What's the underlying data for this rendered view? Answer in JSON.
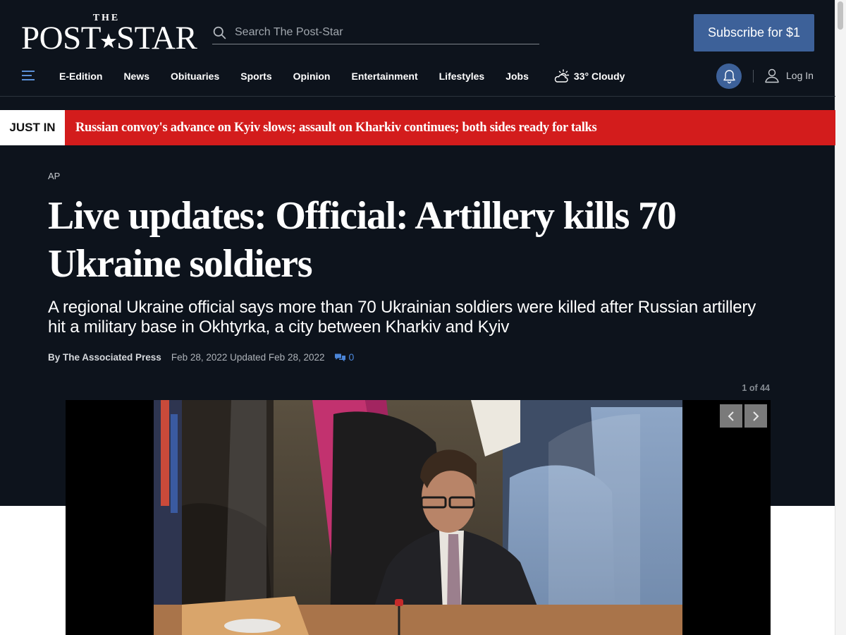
{
  "site": {
    "logo_top": "THE",
    "logo_left": "POST",
    "logo_right": "STAR"
  },
  "search": {
    "placeholder": "Search The Post-Star"
  },
  "subscribe_label": "Subscribe for $1",
  "nav": {
    "items": [
      "E-Edition",
      "News",
      "Obituaries",
      "Sports",
      "Opinion",
      "Entertainment",
      "Lifestyles",
      "Jobs"
    ],
    "weather": "33° Cloudy",
    "login": "Log In"
  },
  "breaking": {
    "label": "JUST IN",
    "headline": "Russian convoy's advance on Kyiv slows; assault on Kharkiv continues; both sides ready for talks"
  },
  "article": {
    "kicker": "AP",
    "headline": "Live updates: Official: Artillery kills 70 Ukraine soldiers",
    "dek": "A regional Ukraine official says more than 70 Ukrainian soldiers were killed after Russian artillery hit a military base in Okhtyrka, a city between Kharkiv and Kyiv",
    "byline": "By The Associated Press",
    "dateline": "Feb 28, 2022 Updated Feb 28, 2022",
    "comment_count": "0"
  },
  "gallery": {
    "counter": "1 of 44"
  },
  "colors": {
    "background": "#0d131c",
    "accent": "#3d6199",
    "breaking": "#d31c1c",
    "comments": "#4b86d9"
  },
  "icons": [
    "search-icon",
    "hamburger-menu-icon",
    "partly-cloudy-icon",
    "bell-icon",
    "user-icon",
    "comment-icon",
    "chevron-left-icon",
    "chevron-right-icon"
  ]
}
